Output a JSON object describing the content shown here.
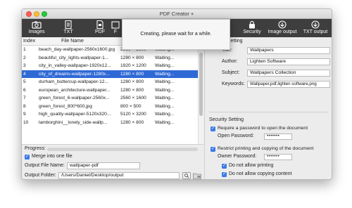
{
  "window": {
    "title": "PDF Creator +"
  },
  "toolbar": {
    "images": "Images",
    "txt": "TXT",
    "pdf": "PDF",
    "partial": "F",
    "security": "Security",
    "image_output": "Image output",
    "txt_output": "TXT output"
  },
  "columns": {
    "index": "Index",
    "file_name": "File Name"
  },
  "files": [
    {
      "index": "1",
      "name": "beach_day-wallpaper-2560x1600.jpg",
      "size": "2560 × 1600",
      "status": "Waiting..."
    },
    {
      "index": "2",
      "name": "beautiful_city_lights-wallpaper-1...",
      "size": "1280 × 800",
      "status": "Waiting..."
    },
    {
      "index": "3",
      "name": "city_in_valley-wallpaper-1920x12...",
      "size": "1920 × 1200",
      "status": "Waiting..."
    },
    {
      "index": "4",
      "name": "city_of_dreams-wallpaper-1280x...",
      "size": "1280 × 800",
      "status": "Waiting..."
    },
    {
      "index": "5",
      "name": "durham_buttercup-wallpaper-12...",
      "size": "1280 × 800",
      "status": "Waiting..."
    },
    {
      "index": "6",
      "name": "european_architecture-wallpaper...",
      "size": "1280 × 800",
      "status": "Waiting..."
    },
    {
      "index": "7",
      "name": "green_forest_6-wallpaper-2560x...",
      "size": "2560 × 1600",
      "status": "Waiting..."
    },
    {
      "index": "8",
      "name": "green_forest_800*600.jpg",
      "size": "800 × 500",
      "status": "Waiting..."
    },
    {
      "index": "9",
      "name": "high_quality-wallpaper-5120x320...",
      "size": "5120 × 3200",
      "status": "Waiting..."
    },
    {
      "index": "10",
      "name": "lamborghini__lonely_side-wallp...",
      "size": "1280 × 800",
      "status": "Waiting..."
    }
  ],
  "bottom": {
    "progress_label": "Progress:",
    "merge_label": "Merge into one file",
    "output_name_label": "Output File Name:",
    "output_name_value": "wallpaper-pdf",
    "output_folder_label": "Output Folder:",
    "output_folder_value": "/Users/Daniel/Desktop/output"
  },
  "metadata": {
    "section_title": "ta Setting",
    "title_label": "Title:",
    "title_value": "Wallpapers",
    "author_label": "Author:",
    "author_value": "Lighten Software",
    "subject_label": "Subject:",
    "subject_value": "Wallpapers Collection",
    "keywords_label": "Keywords:",
    "keywords_value": "Wallpaper,pdf,lighten software,png"
  },
  "security": {
    "section_title": "Security Setting",
    "require_open_label": "Require a password to open the document",
    "open_password_label": "Open Password:",
    "open_password_value": "•••••••",
    "restrict_label": "Restrict printing and copying of the document",
    "owner_password_label": "Owner Password:",
    "owner_password_value": "•••••••",
    "no_print_label": "Do not allow printing",
    "no_copy_label": "Do not allow copying content"
  },
  "dialog": {
    "message": "Creating, please wait for a while."
  },
  "colors": {
    "toolbar": "#3e3e3e",
    "selection": "#2f69d6",
    "checkbox": "#3b7ce6"
  }
}
